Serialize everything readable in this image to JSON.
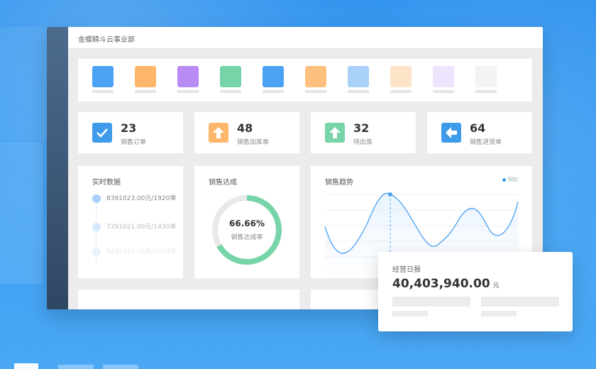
{
  "window": {
    "title": "金蝶精斗云事业部"
  },
  "app_tiles": [
    {
      "name": "app-tile-1",
      "color": "#4ba2f3"
    },
    {
      "name": "app-tile-2",
      "color": "#fdb66a"
    },
    {
      "name": "app-tile-3",
      "color": "#b88cf4"
    },
    {
      "name": "app-tile-4",
      "color": "#76d4a8"
    },
    {
      "name": "app-tile-5",
      "color": "#4ba2f3"
    },
    {
      "name": "app-tile-6",
      "color": "#fdc07f"
    },
    {
      "name": "app-tile-7",
      "color": "#a9d1fa"
    },
    {
      "name": "app-tile-8",
      "color": "#fde3c7"
    },
    {
      "name": "app-tile-9",
      "color": "#eee4fd"
    },
    {
      "name": "app-tile-10",
      "color": "#f1f4f2"
    }
  ],
  "stats": [
    {
      "value": "23",
      "label": "销售订单",
      "icon": "checkmark-icon",
      "color": "#3d9be9"
    },
    {
      "value": "48",
      "label": "销售出库单",
      "icon": "arrow-up-icon",
      "color": "#fdb66a"
    },
    {
      "value": "32",
      "label": "待出库",
      "icon": "arrow-up-icon",
      "color": "#76d4a8"
    },
    {
      "value": "64",
      "label": "销售退货单",
      "icon": "arrow-left-icon",
      "color": "#3d9be9"
    }
  ],
  "realtime": {
    "title": "实时数据",
    "items": [
      {
        "text": "8391023.00元/1920单"
      },
      {
        "text": "7291021.00元/1430单"
      },
      {
        "text": "5291045.00元/1024单"
      }
    ]
  },
  "target": {
    "title": "销售达成",
    "percent_text": "66.66%",
    "percent": 0.6666,
    "caption": "销售达成率",
    "color": "#76d4a8"
  },
  "trend": {
    "title": "销售趋势",
    "legend": "同比"
  },
  "popup": {
    "title": "经营日报",
    "value": "40,403,940.00",
    "unit": "元"
  }
}
